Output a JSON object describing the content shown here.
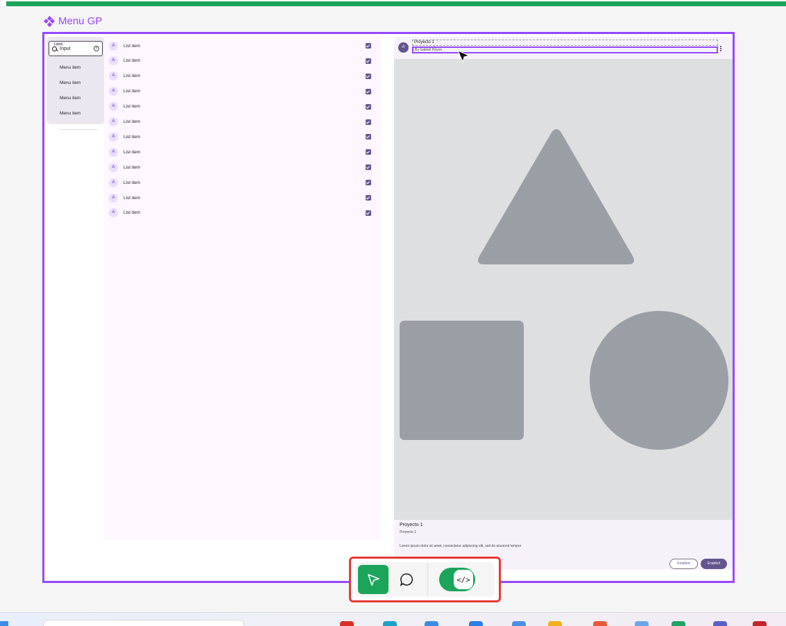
{
  "app": {
    "title": "Menu GP"
  },
  "rail": {
    "search": {
      "label": "Label",
      "value": "Input"
    },
    "menu_items": [
      "Menu item",
      "Menu item",
      "Menu item",
      "Menu item"
    ]
  },
  "list": {
    "items": [
      {
        "avatar": "A",
        "label": "List item",
        "checked": true
      },
      {
        "avatar": "A",
        "label": "List item",
        "checked": true
      },
      {
        "avatar": "A",
        "label": "List item",
        "checked": true
      },
      {
        "avatar": "A",
        "label": "List item",
        "checked": true
      },
      {
        "avatar": "A",
        "label": "List item",
        "checked": true
      },
      {
        "avatar": "A",
        "label": "List item",
        "checked": true
      },
      {
        "avatar": "A",
        "label": "List item",
        "checked": true
      },
      {
        "avatar": "A",
        "label": "List item",
        "checked": true
      },
      {
        "avatar": "A",
        "label": "List item",
        "checked": true
      },
      {
        "avatar": "A",
        "label": "List item",
        "checked": true
      },
      {
        "avatar": "A",
        "label": "List item",
        "checked": true
      },
      {
        "avatar": "A",
        "label": "List item",
        "checked": true
      }
    ]
  },
  "card": {
    "avatar": "A",
    "header_title": "Proyecto 1",
    "header_subtitle": "By Gabriel Hoyos",
    "title": "Proyecto 1",
    "subtitle": "Proyecto 1",
    "body": "Lorem ipsum dolor sit amet, consectetur adipiscing elit, sed do eiusmod tempor",
    "actions": {
      "outlined": "Enabled",
      "filled": "Enabled"
    }
  },
  "toolbar": {
    "tools": [
      "pointer-tool",
      "comment-tool"
    ],
    "active_tool": "pointer-tool",
    "code_mode": "on",
    "code_glyph": "</>"
  },
  "colors": {
    "accent_green": "#1aa55b",
    "frame_purple": "#9747ff",
    "highlight_red": "#e53935",
    "primary": "#65558f"
  }
}
